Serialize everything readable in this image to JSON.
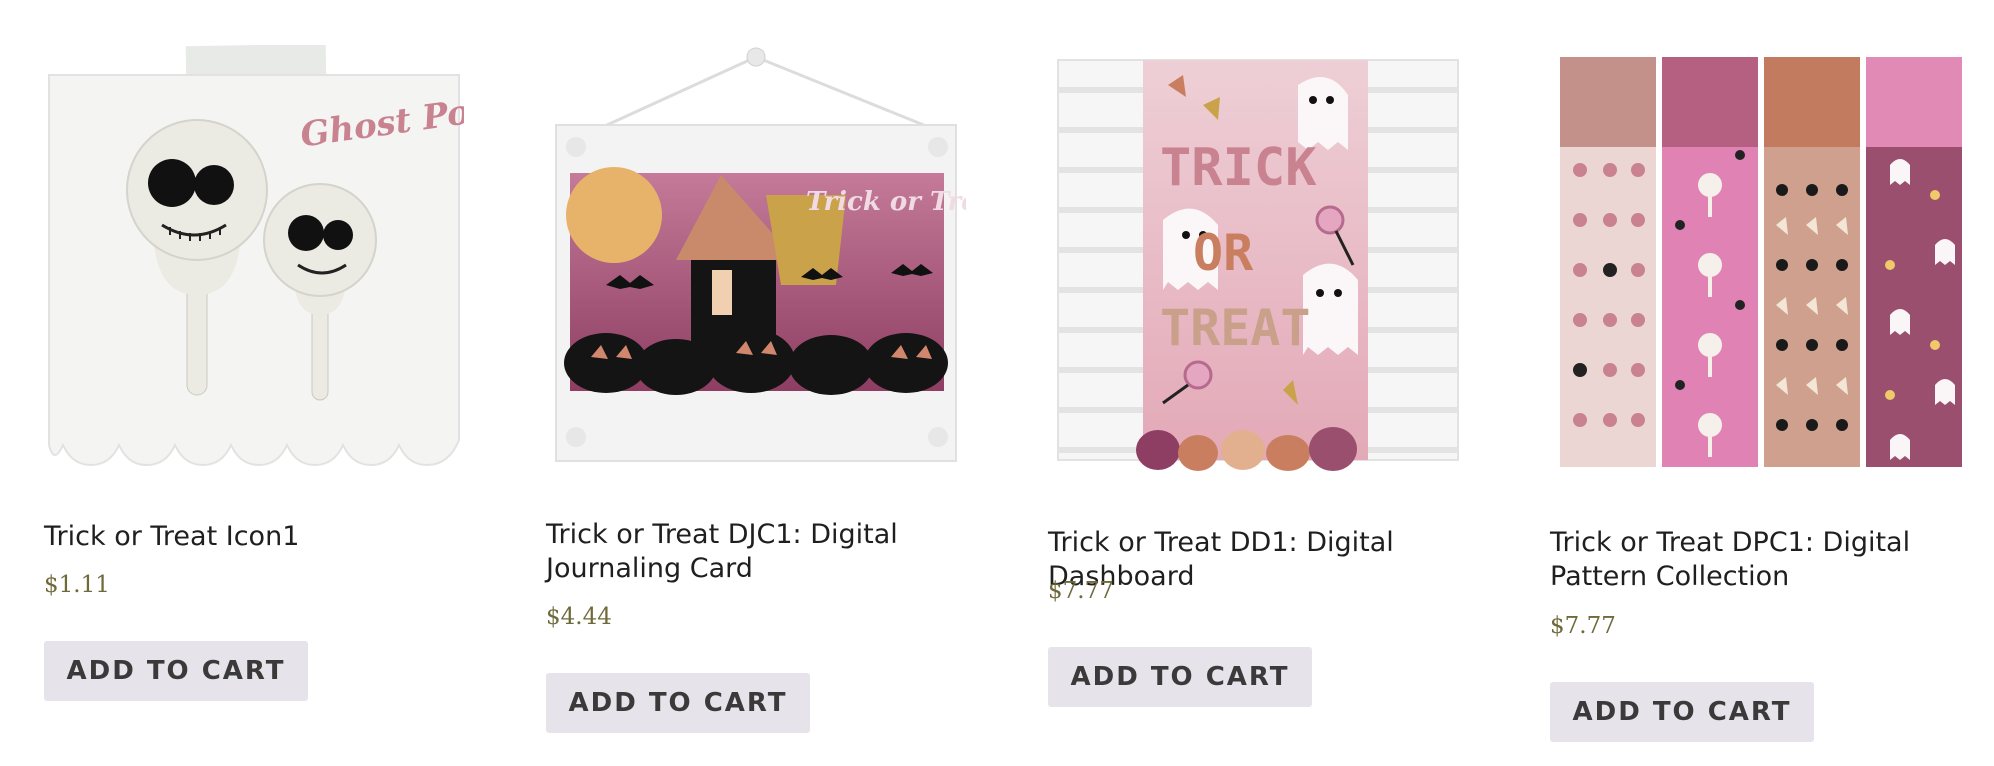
{
  "products": [
    {
      "title": "Trick or Treat Icon1",
      "price": "$1.11",
      "button": "ADD TO CART",
      "image_text": "Ghost Pop"
    },
    {
      "title": "Trick or Treat DJC1: Digital Journaling Card",
      "price": "$4.44",
      "button": "ADD TO CART",
      "image_text": "Trick or Treat"
    },
    {
      "title": "Trick or Treat DD1: Digital Dashboard",
      "price": "$7.77",
      "button": "ADD TO CART",
      "image_text": [
        "TRICK",
        "OR",
        "TREAT"
      ]
    },
    {
      "title": "Trick or Treat DPC1: Digital Pattern Collection",
      "price": "$7.77",
      "button": "ADD TO CART"
    }
  ],
  "colors": {
    "price": "#6f6a3a",
    "button_bg": "#e6e4ea",
    "button_text": "#3a3a3a",
    "mauve": "#c9828f",
    "dusty_pink": "#e8b6c4",
    "terracotta": "#c97f5f",
    "plum": "#9a4f6f"
  }
}
